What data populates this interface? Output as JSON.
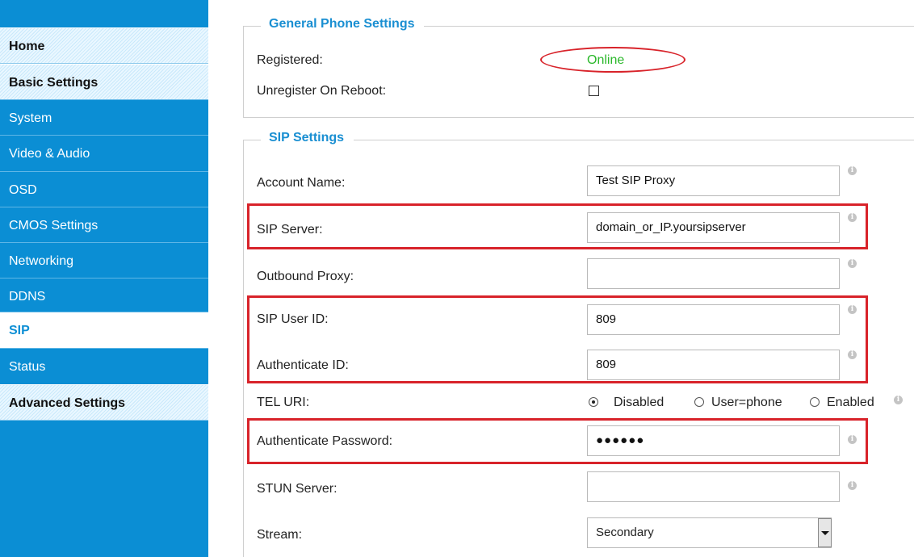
{
  "sidebar": {
    "items": [
      {
        "label": "Home",
        "kind": "header"
      },
      {
        "label": "Basic Settings",
        "kind": "header"
      },
      {
        "label": "System",
        "kind": "link"
      },
      {
        "label": "Video & Audio",
        "kind": "link"
      },
      {
        "label": "OSD",
        "kind": "link"
      },
      {
        "label": "CMOS Settings",
        "kind": "link"
      },
      {
        "label": "Networking",
        "kind": "link"
      },
      {
        "label": "DDNS",
        "kind": "link"
      },
      {
        "label": "SIP",
        "kind": "active"
      },
      {
        "label": "Status",
        "kind": "link"
      },
      {
        "label": "Advanced Settings",
        "kind": "header"
      }
    ]
  },
  "general": {
    "legend": "General Phone Settings",
    "registered_label": "Registered:",
    "registered_value": "Online",
    "unregister_label": "Unregister On Reboot:",
    "unregister_checked": false
  },
  "sip": {
    "legend": "SIP Settings",
    "account_name": {
      "label": "Account Name:",
      "value": "Test SIP Proxy"
    },
    "sip_server": {
      "label": "SIP Server:",
      "value": "domain_or_IP.yoursipserver"
    },
    "outbound_proxy": {
      "label": "Outbound Proxy:",
      "value": ""
    },
    "sip_user_id": {
      "label": "SIP User ID:",
      "value": "809"
    },
    "authenticate_id": {
      "label": "Authenticate ID:",
      "value": "809"
    },
    "tel_uri": {
      "label": "TEL URI:",
      "options": [
        "Disabled",
        "User=phone",
        "Enabled"
      ],
      "selected": "Disabled"
    },
    "authenticate_password": {
      "label": "Authenticate Password:",
      "value": "●●●●●●"
    },
    "stun_server": {
      "label": "STUN Server:",
      "value": ""
    },
    "stream": {
      "label": "Stream:",
      "value": "Secondary"
    }
  },
  "colors": {
    "sidebar_bg": "#0b8ed4",
    "legend": "#1a8fd2",
    "online": "#2ab82a",
    "highlight": "#d8232a"
  },
  "icons": {
    "info": "info-icon"
  }
}
